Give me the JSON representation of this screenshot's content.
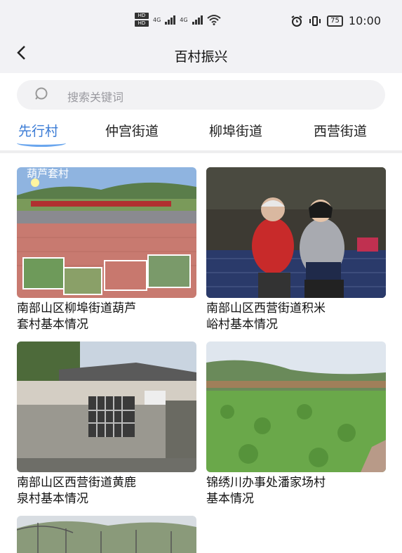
{
  "status": {
    "time": "10:00",
    "battery": "75",
    "signal1": "4G",
    "signal2": "4G"
  },
  "header": {
    "title": "百村振兴"
  },
  "search": {
    "placeholder": "搜索关键词"
  },
  "tabs": [
    {
      "label": "先行村",
      "active": true
    },
    {
      "label": "仲宫街道",
      "active": false
    },
    {
      "label": "柳埠街道",
      "active": false
    },
    {
      "label": "西营街道",
      "active": false
    }
  ],
  "cards": [
    {
      "caption1": "南部山区柳埠街道葫芦",
      "caption2": "套村基本情况",
      "overlay": "葫芦套村"
    },
    {
      "caption1": "南部山区西营街道积米",
      "caption2": "峪村基本情况"
    },
    {
      "caption1": "南部山区西营街道黄鹿",
      "caption2": "泉村基本情况"
    },
    {
      "caption1": "锦绣川办事处潘家场村",
      "caption2": "基本情况"
    }
  ]
}
